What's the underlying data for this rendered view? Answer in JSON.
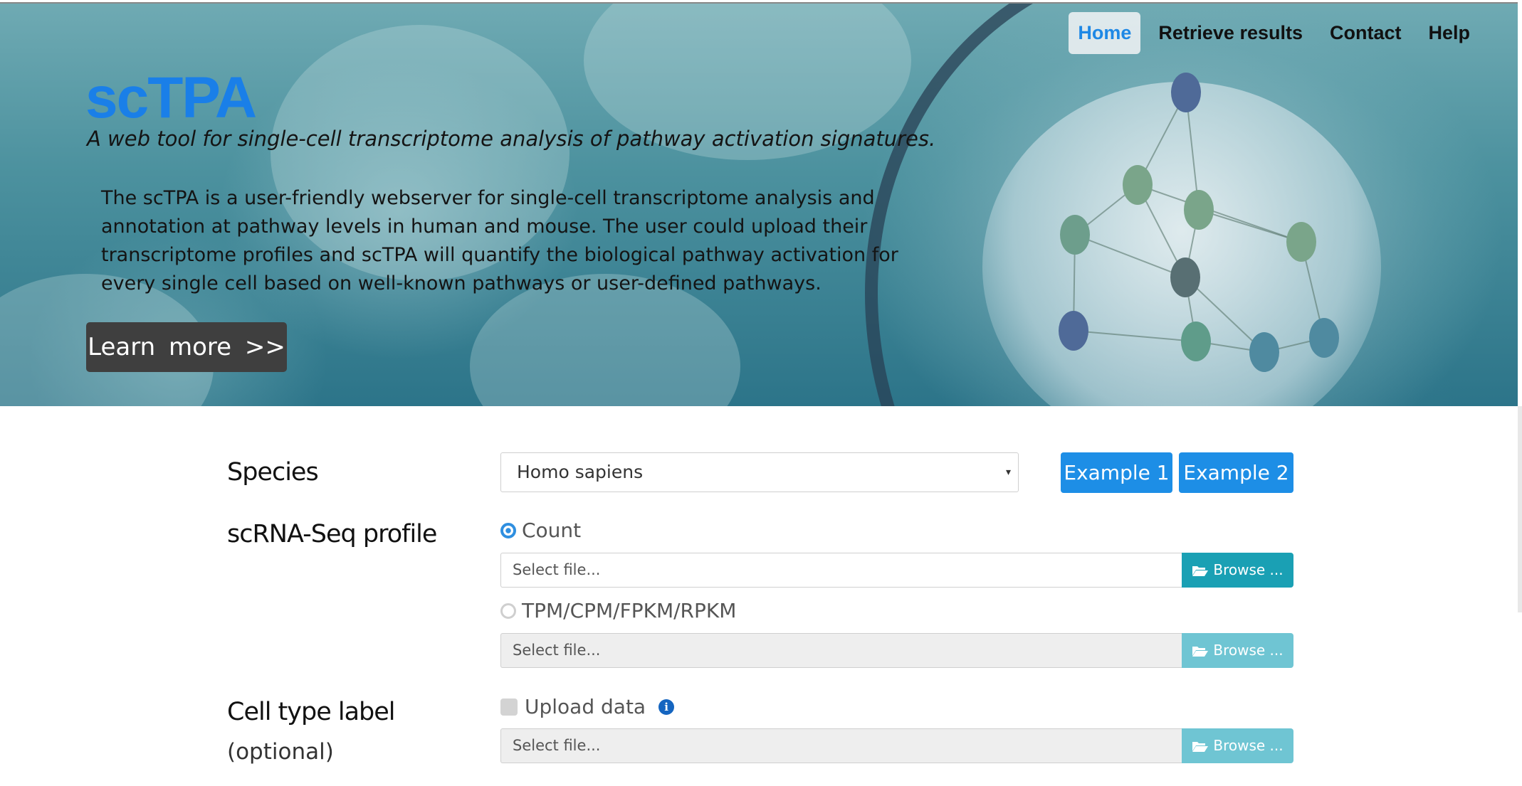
{
  "nav": {
    "items": [
      "Home",
      "Retrieve results",
      "Contact",
      "Help"
    ],
    "active": "Home"
  },
  "hero": {
    "title": "scTPA",
    "tagline": "A web tool for single-cell transcriptome analysis of pathway activation signatures.",
    "description": "The scTPA is a user-friendly webserver for single-cell transcriptome analysis and annotation at pathway levels in human and mouse. The user could upload their transcriptome profiles and scTPA will quantify the biological pathway activation for every single cell based on well-known pathways or user-defined pathways.",
    "learn_more": "Learn  more  >>"
  },
  "form": {
    "species": {
      "label": "Species",
      "selected": "Homo sapiens",
      "example1": "Example 1",
      "example2": "Example 2"
    },
    "profile": {
      "label": "scRNA-Seq profile",
      "count_label": "Count",
      "count_placeholder": "Select file...",
      "tpm_label": "TPM/CPM/FPKM/RPKM",
      "tpm_placeholder": "Select file...",
      "browse": "Browse ..."
    },
    "celltype": {
      "label": "Cell type label",
      "optional": "(optional)",
      "upload_label": "Upload data",
      "placeholder": "Select file...",
      "browse": "Browse ..."
    }
  },
  "colors": {
    "brand": "#1a7fe8",
    "nav_active": "#1e88e5",
    "example_button": "#1d8ee6",
    "browse_enabled": "#1aa0b4",
    "browse_disabled": "#6fc5d3"
  }
}
